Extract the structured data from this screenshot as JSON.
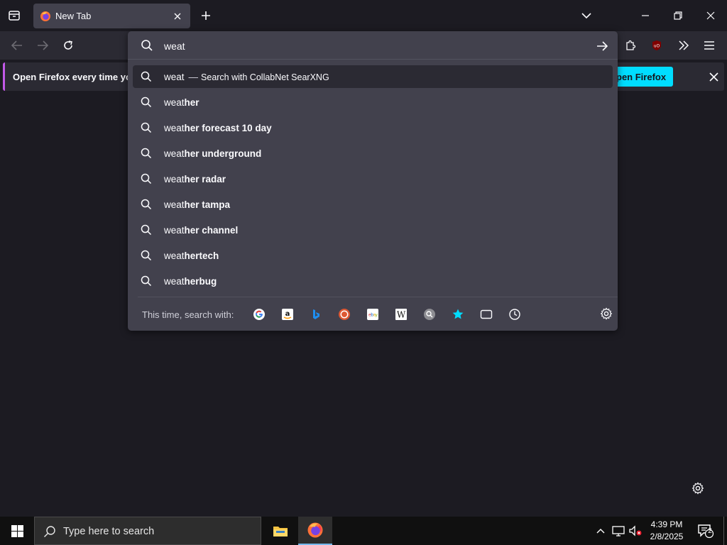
{
  "tab": {
    "title": "New Tab"
  },
  "urlbar": {
    "value": "weat",
    "results": [
      {
        "typed": "weat",
        "completion": "",
        "action": "Search with CollabNet SearXNG",
        "selected": true
      },
      {
        "typed": "weat",
        "completion": "her"
      },
      {
        "typed": "weat",
        "completion": "her forecast 10 day"
      },
      {
        "typed": "weat",
        "completion": "her underground"
      },
      {
        "typed": "weat",
        "completion": "her radar"
      },
      {
        "typed": "weat",
        "completion": "her tampa"
      },
      {
        "typed": "weat",
        "completion": "her channel"
      },
      {
        "typed": "weat",
        "completion": "hertech"
      },
      {
        "typed": "weat",
        "completion": "herbug"
      }
    ],
    "oneoff_label": "This time, search with:",
    "engines": [
      "google-icon",
      "amazon-icon",
      "bing-icon",
      "duckduckgo-icon",
      "ebay-icon",
      "wikipedia-icon",
      "searxng-icon",
      "bookmarks-icon",
      "tabs-icon",
      "history-icon"
    ]
  },
  "notice": {
    "text": "Open Firefox every time you",
    "button": "pen Firefox"
  },
  "taskbar": {
    "search_placeholder": "Type here to search",
    "time": "4:39 PM",
    "date": "2/8/2025",
    "notification_count": "2"
  },
  "colors": {
    "accent": "#00ddff",
    "notice_stripe": "#c259e8",
    "popup_bg": "#42414d",
    "toolbar_bg": "#2b2a33",
    "page_bg": "#1c1b22"
  }
}
